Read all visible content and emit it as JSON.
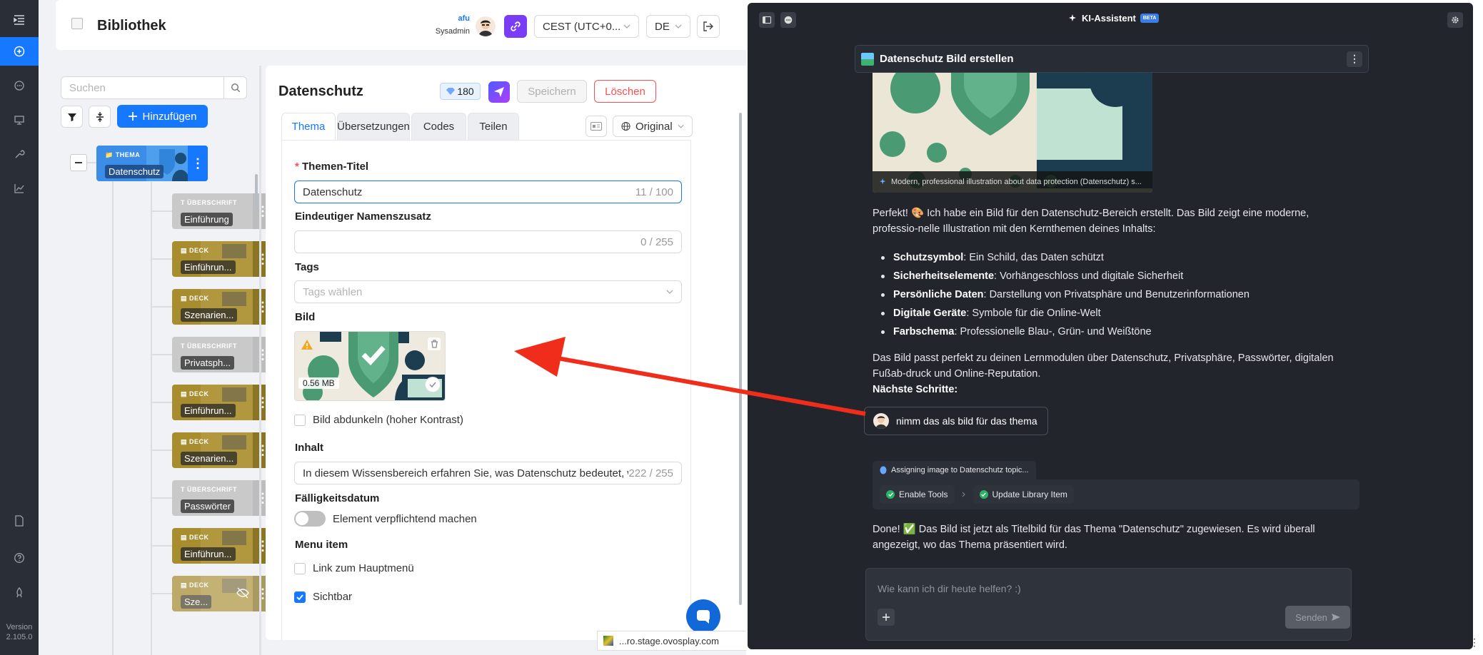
{
  "rail": {
    "version_label": "Version",
    "version_number": "2.105.0"
  },
  "header": {
    "title": "Bibliothek",
    "user_name": "afu",
    "user_role": "Sysadmin",
    "timezone": "CEST (UTC+0...",
    "language": "DE"
  },
  "library": {
    "search_placeholder": "Suchen",
    "add_label": "Hinzufügen",
    "tree": {
      "root": {
        "type": "THEMA",
        "name": "Datenschutz"
      },
      "children": [
        {
          "type": "ÜBERSCHRIFT",
          "name": "Einführung"
        },
        {
          "type": "DECK",
          "name": "Einführun..."
        },
        {
          "type": "DECK",
          "name": "Szenarien..."
        },
        {
          "type": "ÜBERSCHRIFT",
          "name": "Privatsph..."
        },
        {
          "type": "DECK",
          "name": "Einführun..."
        },
        {
          "type": "DECK",
          "name": "Szenarien..."
        },
        {
          "type": "ÜBERSCHRIFT",
          "name": "Passwörter"
        },
        {
          "type": "DECK",
          "name": "Einführun..."
        },
        {
          "type": "DECK",
          "name": "Sze..."
        }
      ]
    }
  },
  "editor": {
    "title": "Datenschutz",
    "credits": "180",
    "save_label": "Speichern",
    "delete_label": "Löschen",
    "tabs": [
      "Thema",
      "Übersetzungen",
      "Codes",
      "Teilen"
    ],
    "language_select": "Original",
    "form": {
      "title_label": "Themen-Titel",
      "title_value": "Datenschutz",
      "title_count": "11 / 100",
      "suffix_label": "Eindeutiger Namenszusatz",
      "suffix_count": "0 / 255",
      "tags_label": "Tags",
      "tags_placeholder": "Tags wählen",
      "image_label": "Bild",
      "image_size": "0.56 MB",
      "darken_label": "Bild abdunkeln (hoher Kontrast)",
      "content_label": "Inhalt",
      "content_value": "In diesem Wissensbereich erfahren Sie, was Datenschutz bedeutet, we",
      "content_count": "222 / 255",
      "due_label": "Fälligkeitsdatum",
      "mandatory_label": "Element verpflichtend machen",
      "menu_label": "Menu item",
      "main_menu_label": "Link zum Hauptmenü",
      "visible_label": "Sichtbar",
      "visible_checked": true
    }
  },
  "status_url": "...ro.stage.ovosplay.com",
  "assistant": {
    "title": "KI-Assistent",
    "beta": "BETA",
    "card_title": "Datenschutz Bild erstellen",
    "image_caption": "Modern, professional illustration about data protection (Datenschutz) s...",
    "intro": "Perfekt! 🎨 Ich habe ein Bild für den Datenschutz-Bereich erstellt. Das Bild zeigt eine moderne, professio-nelle Illustration mit den Kernthemen deines Inhalts:",
    "bullets": [
      {
        "term": "Schutzsymbol",
        "text": ": Ein Schild, das Daten schützt"
      },
      {
        "term": "Sicherheitselemente",
        "text": ": Vorhängeschloss und digitale Sicherheit"
      },
      {
        "term": "Persönliche Daten",
        "text": ": Darstellung von Privatsphäre und Benutzerinformationen"
      },
      {
        "term": "Digitale Geräte",
        "text": ": Symbole für die Online-Welt"
      },
      {
        "term": "Farbschema",
        "text": ": Professionelle Blau-, Grün- und Weißtöne"
      }
    ],
    "fits": "Das Bild passt perfekt zu deinen Lernmodulen über Datenschutz, Privatsphäre, Passwörter, digitalen Fußab-druck und Online-Reputation.",
    "next_steps": "Nächste Schritte:",
    "user_msg": "nimm das als bild für das thema",
    "tool_title": "Assigning image to Datenschutz topic...",
    "tool_steps": [
      "Enable Tools",
      "Update Library Item"
    ],
    "done_msg": "Done! ✅ Das Bild ist jetzt als Titelbild für das Thema \"Datenschutz\" zugewiesen. Es wird überall angezeigt, wo das Thema präsentiert wird.",
    "input_placeholder": "Wie kann ich dir heute helfen? :)",
    "send_label": "Senden"
  },
  "colors": {
    "accent": "#1677ff",
    "danger": "#ff4d4f",
    "annotation": "#f02d1a",
    "assistant_bg": "#22252c"
  }
}
